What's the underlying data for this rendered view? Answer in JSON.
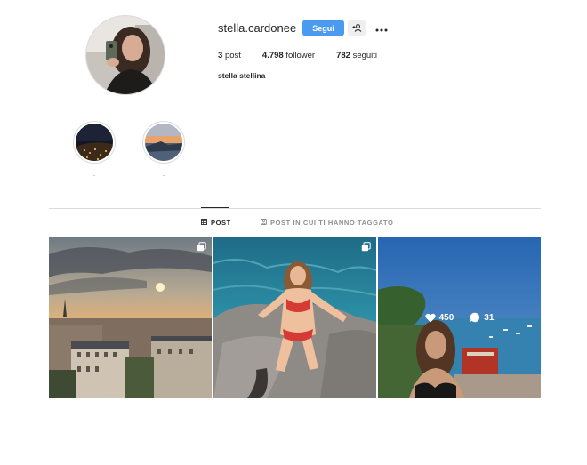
{
  "profile": {
    "username": "stella.cardonee",
    "follow_label": "Segui",
    "full_name": "stella stellina",
    "stats": {
      "posts_count": "3",
      "posts_label": "post",
      "followers_count": "4.798",
      "followers_label": "follower",
      "following_count": "782",
      "following_label": "seguiti"
    }
  },
  "highlights": [
    {
      "label": "."
    },
    {
      "label": "."
    }
  ],
  "tabs": [
    {
      "label": "POST",
      "icon": "grid-icon",
      "active": true
    },
    {
      "label": "POST IN CUI TI HANNO TAGGATO",
      "icon": "tagged-icon",
      "active": false
    }
  ],
  "posts": [
    {
      "icon": "carousel-icon"
    },
    {
      "icon": "carousel-icon"
    },
    {
      "likes": "450",
      "comments": "31"
    }
  ],
  "colors": {
    "accent": "#4a9af0",
    "text": "#262626",
    "muted": "#8e8e8e",
    "border": "#dbdbdb"
  }
}
